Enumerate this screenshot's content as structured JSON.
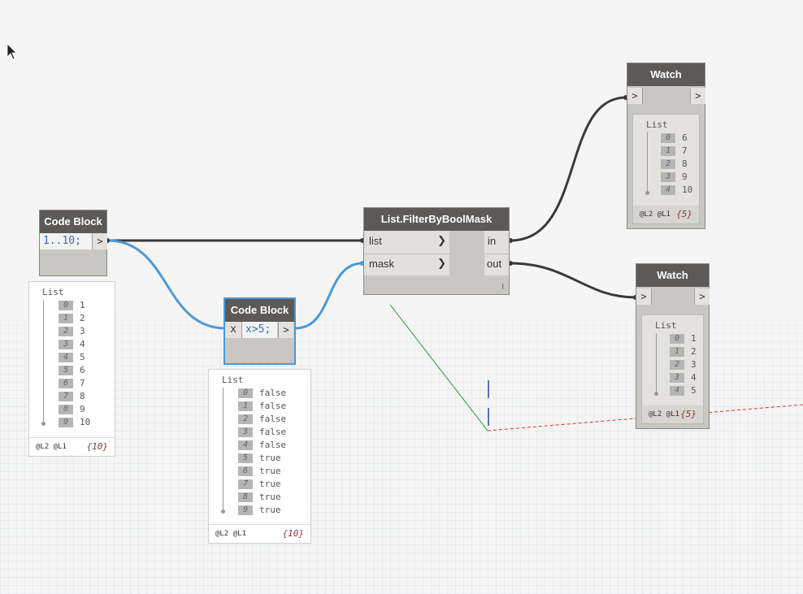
{
  "nodes": {
    "code_block_1": {
      "title": "Code Block",
      "code": "1..10;",
      "output_arrow": ">",
      "preview": {
        "title": "List",
        "items": [
          {
            "index": "0",
            "value": "1"
          },
          {
            "index": "1",
            "value": "2"
          },
          {
            "index": "2",
            "value": "3"
          },
          {
            "index": "3",
            "value": "4"
          },
          {
            "index": "4",
            "value": "5"
          },
          {
            "index": "5",
            "value": "6"
          },
          {
            "index": "6",
            "value": "7"
          },
          {
            "index": "7",
            "value": "8"
          },
          {
            "index": "8",
            "value": "9"
          },
          {
            "index": "9",
            "value": "10"
          }
        ],
        "levels": "@L2 @L1",
        "count": "{10}"
      }
    },
    "code_block_2": {
      "title": "Code Block",
      "input_port": "x",
      "code": "x>5;",
      "output_arrow": ">",
      "preview": {
        "title": "List",
        "items": [
          {
            "index": "0",
            "value": "false"
          },
          {
            "index": "1",
            "value": "false"
          },
          {
            "index": "2",
            "value": "false"
          },
          {
            "index": "3",
            "value": "false"
          },
          {
            "index": "4",
            "value": "false"
          },
          {
            "index": "5",
            "value": "true"
          },
          {
            "index": "6",
            "value": "true"
          },
          {
            "index": "7",
            "value": "true"
          },
          {
            "index": "8",
            "value": "true"
          },
          {
            "index": "9",
            "value": "true"
          }
        ],
        "levels": "@L2 @L1",
        "count": "{10}"
      }
    },
    "filter": {
      "title": "List.FilterByBoolMask",
      "inputs": [
        "list",
        "mask"
      ],
      "outputs": [
        "in",
        "out"
      ],
      "lacing": "l"
    },
    "watch_1": {
      "title": "Watch",
      "input_arrow": ">",
      "output_arrow": ">",
      "preview": {
        "title": "List",
        "items": [
          {
            "index": "0",
            "value": "6"
          },
          {
            "index": "1",
            "value": "7"
          },
          {
            "index": "2",
            "value": "8"
          },
          {
            "index": "3",
            "value": "9"
          },
          {
            "index": "4",
            "value": "10"
          }
        ],
        "levels": "@L2 @L1",
        "count": "{5}"
      }
    },
    "watch_2": {
      "title": "Watch",
      "input_arrow": ">",
      "output_arrow": ">",
      "preview": {
        "title": "List",
        "items": [
          {
            "index": "0",
            "value": "1"
          },
          {
            "index": "1",
            "value": "2"
          },
          {
            "index": "2",
            "value": "3"
          },
          {
            "index": "3",
            "value": "4"
          },
          {
            "index": "4",
            "value": "5"
          }
        ],
        "levels": "@L2 @L1",
        "count": "{5}"
      }
    }
  },
  "colors": {
    "wire_dark": "#3a3a3a",
    "wire_selected": "#4c9ad5",
    "node_header": "#5c5a58",
    "node_body": "#c9c7c3",
    "grid": "#c5d4dc"
  }
}
